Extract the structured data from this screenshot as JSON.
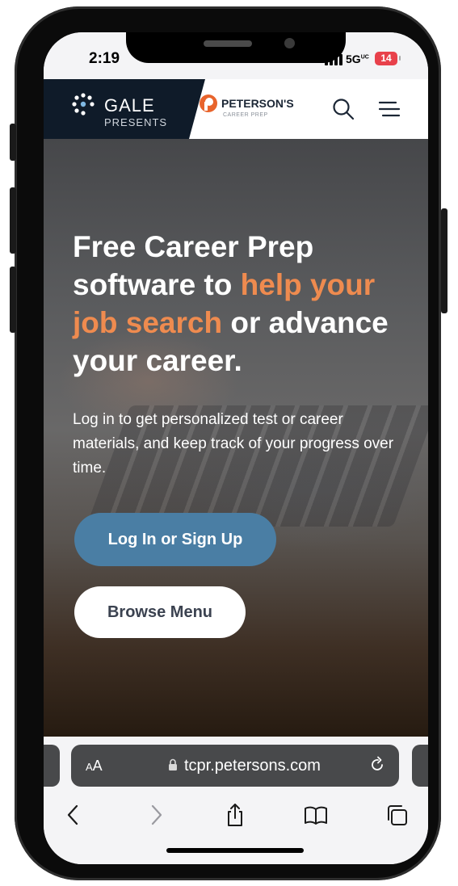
{
  "status_bar": {
    "time": "2:19",
    "network": "5G",
    "network_suffix": "UC",
    "battery": "14"
  },
  "header": {
    "gale_title": "GALE",
    "gale_sub": "PRESENTS",
    "petersons_title": "PETERSON'S",
    "petersons_sub": "CAREER PREP",
    "search_icon": "search-icon",
    "menu_icon": "hamburger-menu-icon"
  },
  "hero": {
    "headline_1": "Free Career Prep software to ",
    "headline_accent": "help your job search",
    "headline_2": " or advance your career.",
    "subtext": "Log in to get personalized test or career materials, and keep track of your progress over time.",
    "login_label": "Log In or Sign Up",
    "browse_label": "Browse Menu"
  },
  "colors": {
    "accent": "#ef8b4f",
    "primary_button": "#4a7ea4",
    "gale_dark": "#0f1b29",
    "petersons_orange": "#e8642c"
  },
  "browser": {
    "aa_large": "A",
    "aa_small": "A",
    "url": "tcpr.petersons.com",
    "icons": [
      "back-icon",
      "forward-icon",
      "share-icon",
      "bookmarks-icon",
      "tabs-icon"
    ]
  }
}
